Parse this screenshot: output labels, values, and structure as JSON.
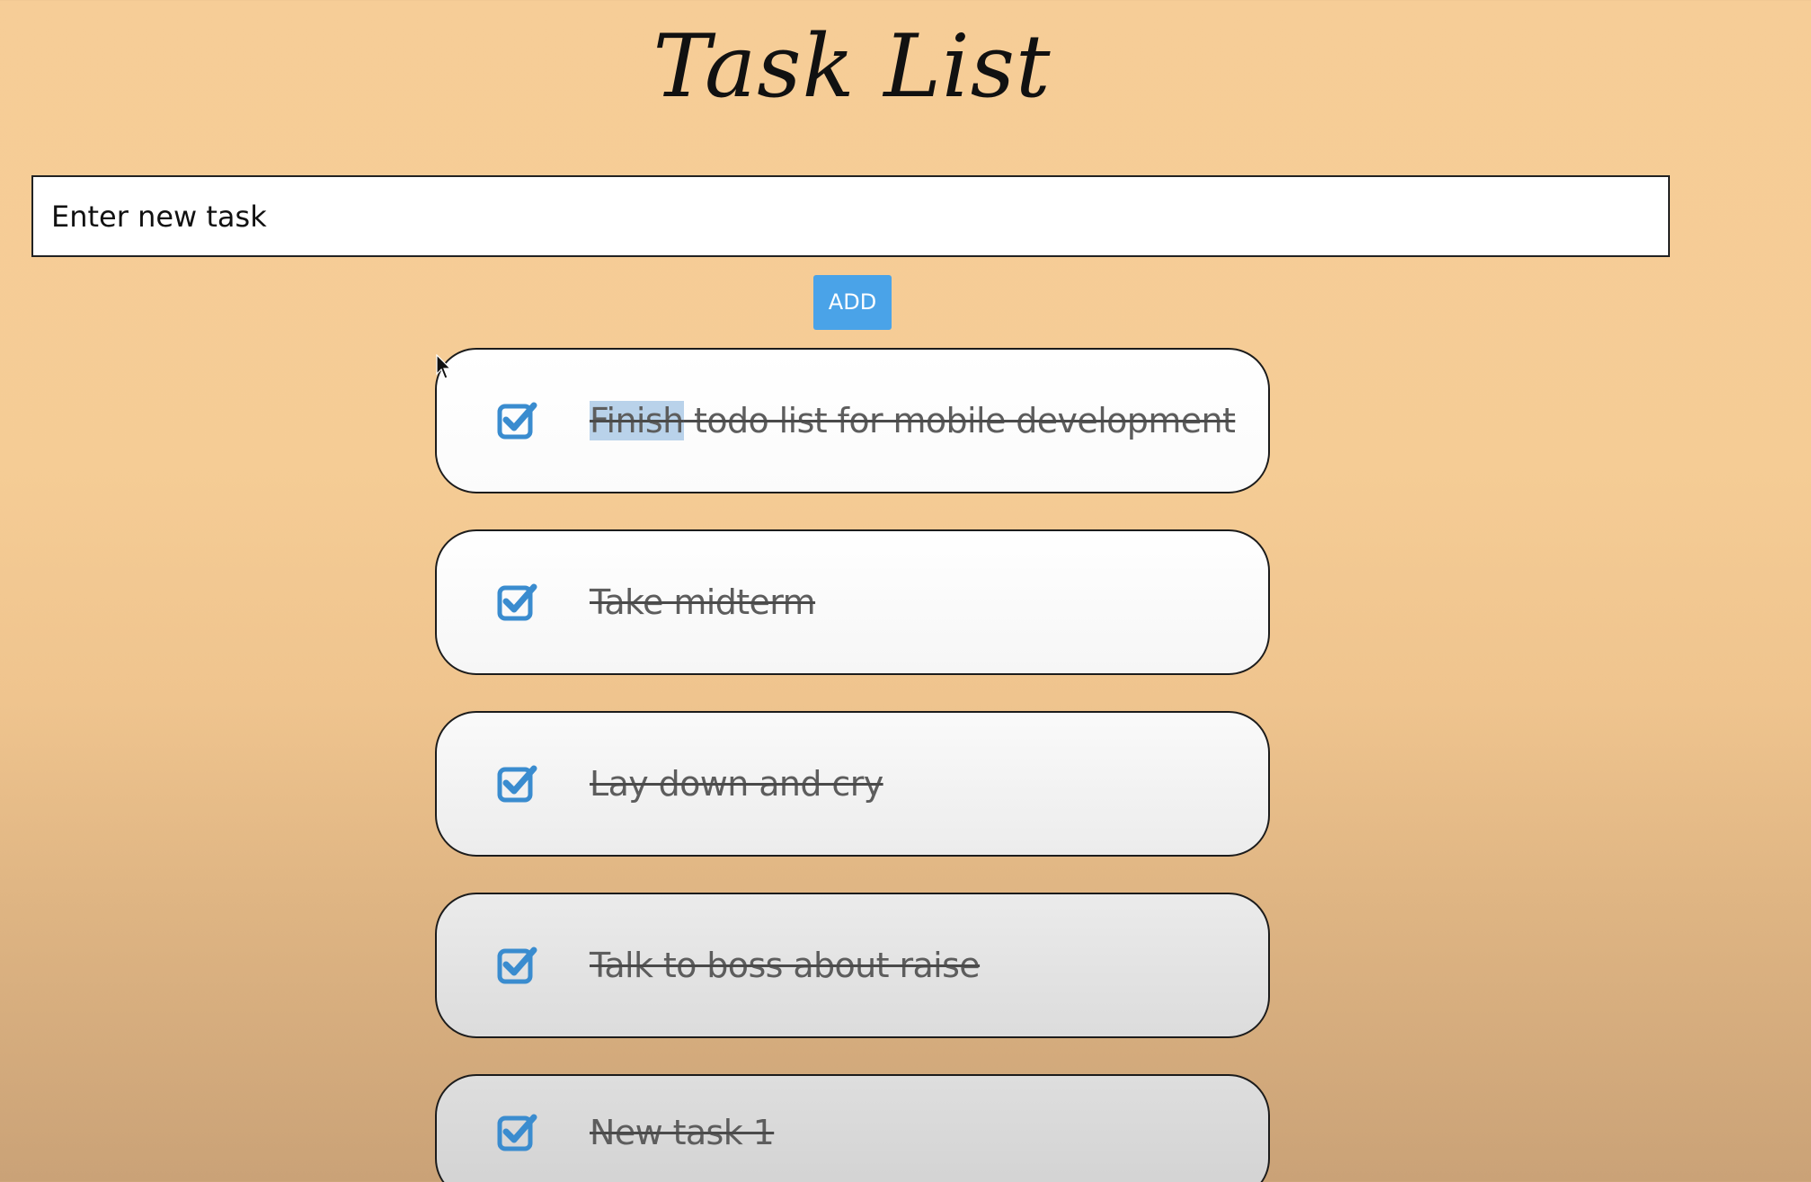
{
  "page": {
    "title": "Task List"
  },
  "new_task": {
    "placeholder": "Enter new task",
    "value": ""
  },
  "add_button": {
    "label": "ADD"
  },
  "tasks": [
    {
      "highlighted": "Finish",
      "rest": " todo list for mobile development",
      "completed": true
    },
    {
      "label": "Take midterm",
      "completed": true
    },
    {
      "label": "Lay down and cry",
      "completed": true
    },
    {
      "label": "Talk to boss about raise",
      "completed": true
    },
    {
      "label": "New task 1",
      "completed": true
    }
  ],
  "icons": {
    "checkbox": "checkbox-checked-icon",
    "cursor": "mouse-pointer-icon"
  },
  "colors": {
    "accent": "#4aa3e8",
    "checkbox": "#3a8ccf",
    "selection_highlight": "#b9d2ea",
    "background": "#f6cd97"
  }
}
